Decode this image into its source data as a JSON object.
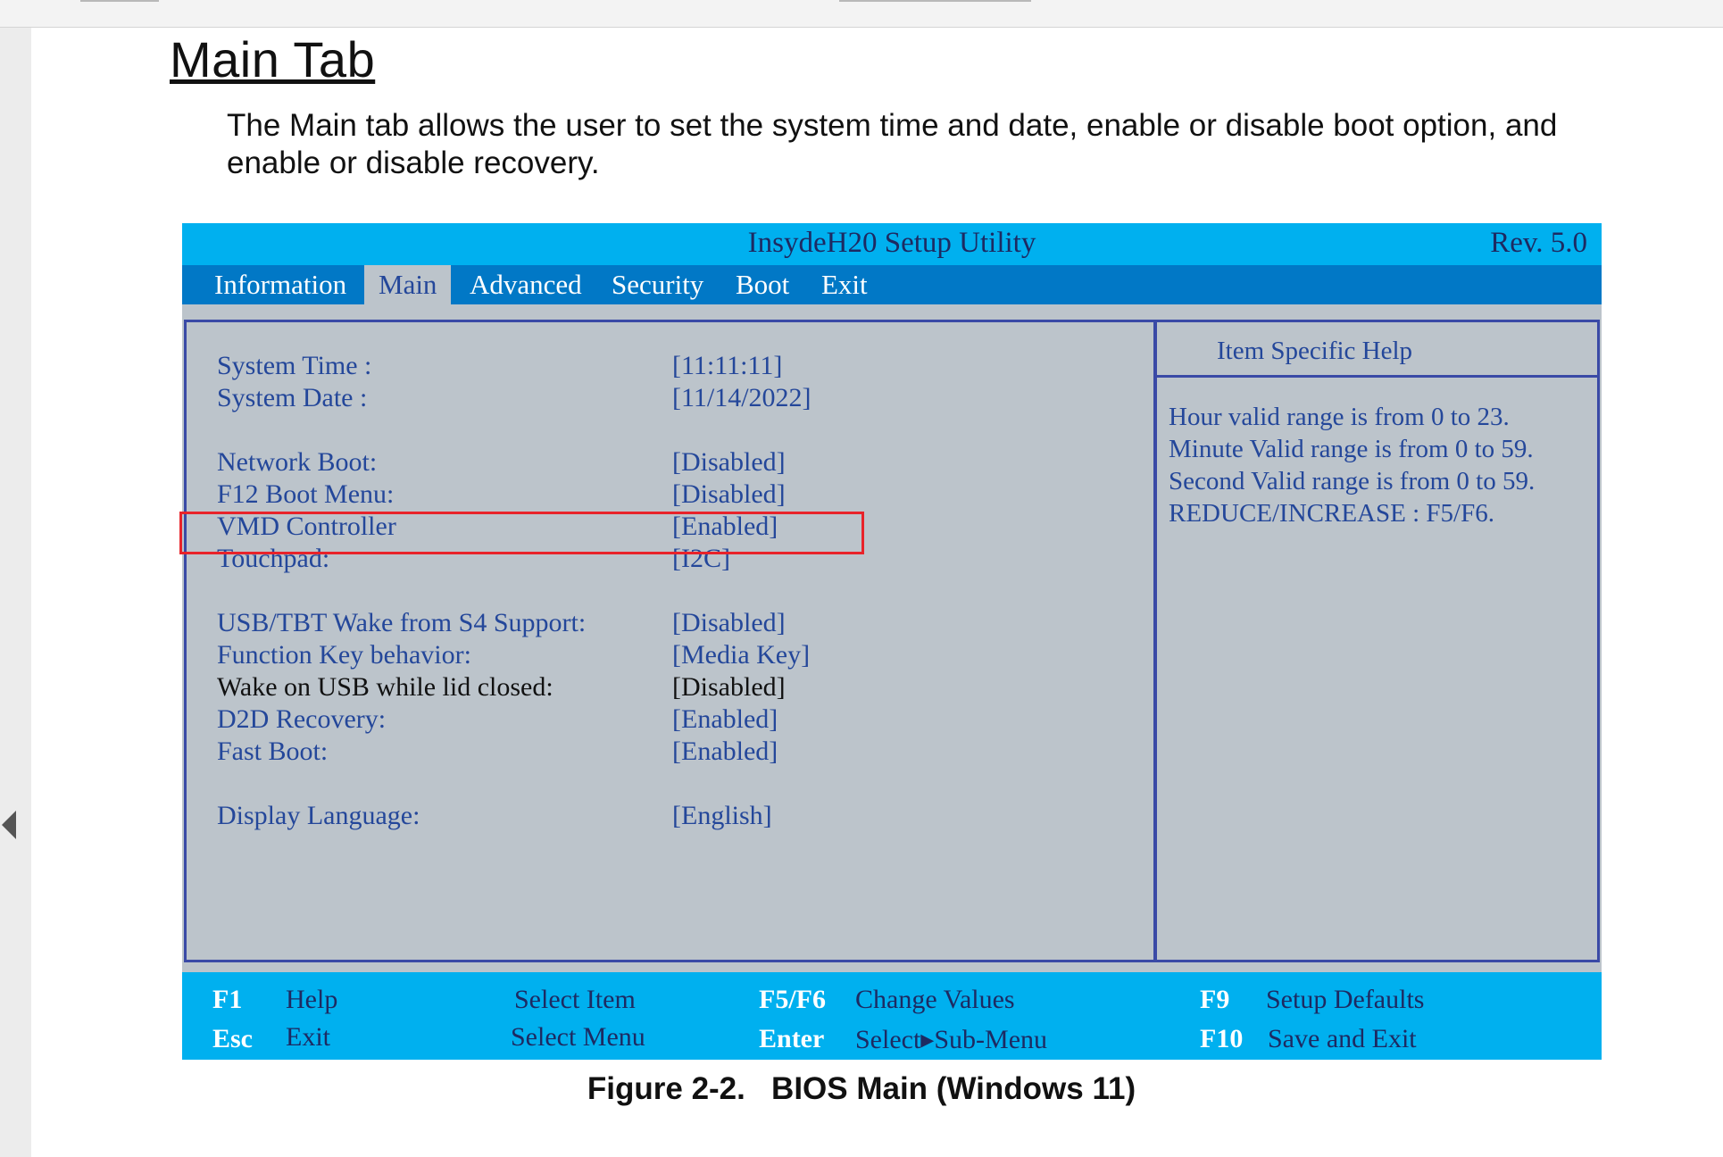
{
  "document": {
    "heading": "Main Tab",
    "intro": "The Main tab allows the user to set the system time and date, enable or disable boot option, and enable or disable recovery.",
    "caption": "Figure 2-2.   BIOS Main (Windows 11)"
  },
  "bios": {
    "title": "InsydeH20 Setup Utility",
    "rev": "Rev. 5.0",
    "tabs": [
      "Information",
      "Main",
      "Advanced",
      "Security",
      "Boot",
      "Exit"
    ],
    "active_tab": "Main",
    "settings": [
      {
        "label": "System Time :",
        "value": "[11:11:11]"
      },
      {
        "label": "System Date :",
        "value": "[11/14/2022]"
      },
      {
        "label": "Network Boot:",
        "value": "[Disabled]"
      },
      {
        "label": "F12 Boot Menu:",
        "value": "[Disabled]"
      },
      {
        "label": "VMD Controller",
        "value": "[Enabled]"
      },
      {
        "label": "Touchpad:",
        "value": "[I2C]"
      },
      {
        "label": "USB/TBT Wake from S4 Support:",
        "value": "[Disabled]"
      },
      {
        "label": "Function Key behavior:",
        "value": "[Media Key]"
      },
      {
        "label": "Wake on USB while lid closed:",
        "value": "[Disabled]"
      },
      {
        "label": "D2D Recovery:",
        "value": "[Enabled]"
      },
      {
        "label": "Fast Boot:",
        "value": "[Enabled]"
      },
      {
        "label": "Display Language:",
        "value": "[English]"
      }
    ],
    "help": {
      "title": "Item Specific Help",
      "lines": [
        "Hour valid range is from 0 to 23.",
        "Minute Valid range is from 0 to 59.",
        "Second Valid range is from 0 to 59.",
        "REDUCE/INCREASE : F5/F6."
      ]
    },
    "footer": [
      {
        "key": "F1",
        "desc": "Help"
      },
      {
        "key": "Esc",
        "desc": "Exit"
      },
      {
        "key": "",
        "desc": "Select Item"
      },
      {
        "key": "",
        "desc": "Select Menu"
      },
      {
        "key": "F5/F6",
        "desc": "Change Values"
      },
      {
        "key": "Enter",
        "desc": "Select▸Sub-Menu"
      },
      {
        "key": "F9",
        "desc": "Setup Defaults"
      },
      {
        "key": "F10",
        "desc": "Save and Exit"
      }
    ],
    "colors": {
      "title_bar": "#00b0ef",
      "menu_bar": "#0178c6",
      "panel_bg": "#bcc4cb",
      "text_blue": "#24479a",
      "highlight_red": "#e8232a"
    }
  }
}
